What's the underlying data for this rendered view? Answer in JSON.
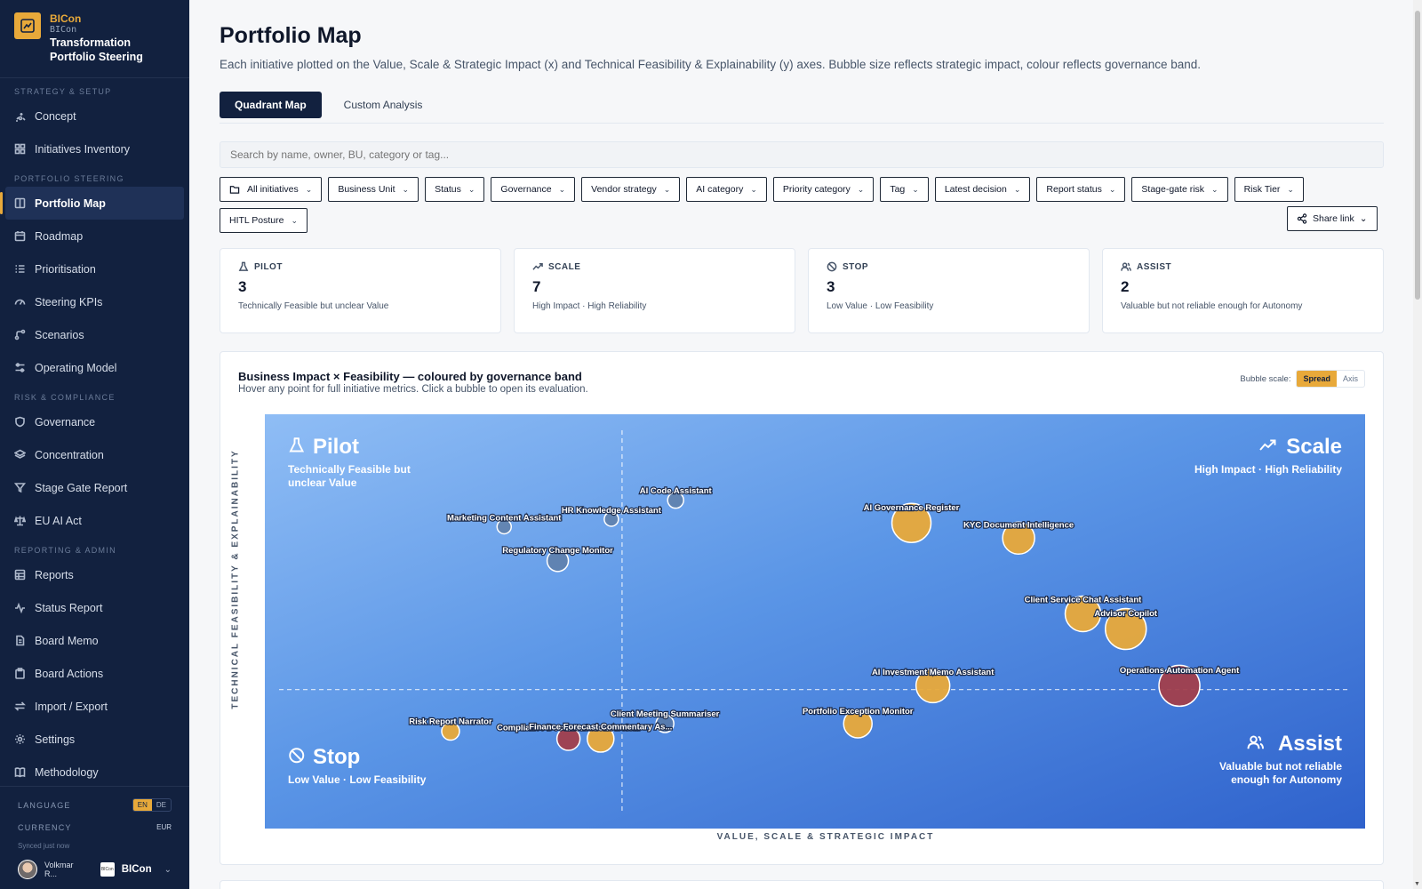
{
  "brand": {
    "name": "BICon",
    "code": "BICon",
    "app_title": "Transformation Portfolio Steering"
  },
  "nav": {
    "sections": [
      {
        "label": "STRATEGY & SETUP",
        "items": [
          {
            "label": "Concept",
            "icon": "sparkle-icon"
          },
          {
            "label": "Initiatives Inventory",
            "icon": "grid-icon"
          }
        ]
      },
      {
        "label": "PORTFOLIO STEERING",
        "items": [
          {
            "label": "Portfolio Map",
            "icon": "map-icon",
            "active": true
          },
          {
            "label": "Roadmap",
            "icon": "calendar-icon"
          },
          {
            "label": "Prioritisation",
            "icon": "list-icon"
          },
          {
            "label": "Steering KPIs",
            "icon": "gauge-icon"
          },
          {
            "label": "Scenarios",
            "icon": "branch-icon"
          },
          {
            "label": "Operating Model",
            "icon": "sliders-icon"
          }
        ]
      },
      {
        "label": "RISK & COMPLIANCE",
        "items": [
          {
            "label": "Governance",
            "icon": "shield-icon"
          },
          {
            "label": "Concentration",
            "icon": "layers-icon"
          },
          {
            "label": "Stage Gate Report",
            "icon": "funnel-icon"
          },
          {
            "label": "EU AI Act",
            "icon": "scale-icon"
          }
        ]
      },
      {
        "label": "REPORTING & ADMIN",
        "items": [
          {
            "label": "Reports",
            "icon": "table-icon"
          },
          {
            "label": "Status Report",
            "icon": "pulse-icon"
          },
          {
            "label": "Board Memo",
            "icon": "document-icon"
          },
          {
            "label": "Board Actions",
            "icon": "clipboard-icon"
          },
          {
            "label": "Import / Export",
            "icon": "swap-icon"
          },
          {
            "label": "Settings",
            "icon": "gear-icon"
          },
          {
            "label": "Methodology",
            "icon": "book-icon"
          }
        ]
      }
    ]
  },
  "footer": {
    "language_label": "LANGUAGE",
    "lang_en": "EN",
    "lang_de": "DE",
    "currency_label": "CURRENCY",
    "currency": "EUR",
    "synced": "Synced just now",
    "user": "Volkmar R...",
    "org": "BICon"
  },
  "page": {
    "title": "Portfolio Map",
    "subtitle": "Each initiative plotted on the Value, Scale & Strategic Impact (x) and Technical Feasibility & Explainability (y) axes. Bubble size reflects strategic impact, colour reflects governance band.",
    "tabs": [
      {
        "label": "Quadrant Map",
        "active": true
      },
      {
        "label": "Custom Analysis"
      }
    ],
    "search_placeholder": "Search by name, owner, BU, category or tag...",
    "filters": [
      "All initiatives",
      "Business Unit",
      "Status",
      "Governance",
      "Vendor strategy",
      "AI category",
      "Priority category",
      "Tag",
      "Latest decision",
      "Report status",
      "Stage-gate risk",
      "Risk Tier",
      "HITL Posture"
    ],
    "share_label": "Share link"
  },
  "cards": [
    {
      "label": "PILOT",
      "count": "3",
      "desc": "Technically Feasible but unclear Value",
      "icon": "flask-icon"
    },
    {
      "label": "SCALE",
      "count": "7",
      "desc": "High Impact · High Reliability",
      "icon": "trend-up-icon"
    },
    {
      "label": "STOP",
      "count": "3",
      "desc": "Low Value · Low Feasibility",
      "icon": "ban-icon"
    },
    {
      "label": "ASSIST",
      "count": "2",
      "desc": "Valuable but not reliable enough for Autonomy",
      "icon": "users-icon"
    }
  ],
  "chart_panel": {
    "title": "Business Impact × Feasibility — coloured by governance band",
    "subtitle": "Hover any point for full initiative metrics. Click a bubble to open its evaluation.",
    "bubble_scale_label": "Bubble scale:",
    "spread": "Spread",
    "axis": "Axis"
  },
  "chart_data": {
    "type": "scatter",
    "xlabel": "VALUE, SCALE & STRATEGIC IMPACT",
    "ylabel": "TECHNICAL FEASIBILITY & EXPLAINABILITY",
    "xlim": [
      0,
      100
    ],
    "ylim": [
      0,
      100
    ],
    "dividers": {
      "x": 32,
      "y": 32
    },
    "quadrants": [
      {
        "name": "Pilot",
        "desc": "Technically Feasible but unclear Value",
        "pos": "top-left",
        "icon": "flask-icon"
      },
      {
        "name": "Scale",
        "desc": "High Impact · High Reliability",
        "pos": "top-right",
        "icon": "trend-up-icon"
      },
      {
        "name": "Stop",
        "desc": "Low Value · Low Feasibility",
        "pos": "bottom-left",
        "icon": "ban-icon"
      },
      {
        "name": "Assist",
        "desc": "Valuable but not reliable enough for Autonomy",
        "pos": "bottom-right",
        "icon": "users-icon"
      }
    ],
    "colors": {
      "amber": "#e8a93a",
      "red": "#a23f4c",
      "slate": "#5b7393"
    },
    "points": [
      {
        "name": "AI Code Assistant",
        "x": 37,
        "y": 82,
        "size": 9,
        "band": "slate"
      },
      {
        "name": "HR Knowledge Assistant",
        "x": 31,
        "y": 77,
        "size": 8,
        "band": "slate"
      },
      {
        "name": "Marketing Content Assistant",
        "x": 21,
        "y": 75,
        "size": 8,
        "band": "slate"
      },
      {
        "name": "Regulatory Change Monitor",
        "x": 26,
        "y": 66,
        "size": 12,
        "band": "slate"
      },
      {
        "name": "AI Governance Register",
        "x": 59,
        "y": 76,
        "size": 22,
        "band": "amber"
      },
      {
        "name": "KYC Document Intelligence",
        "x": 69,
        "y": 72,
        "size": 18,
        "band": "amber"
      },
      {
        "name": "Client Service Chat Assistant",
        "x": 75,
        "y": 52,
        "size": 20,
        "band": "amber"
      },
      {
        "name": "Advisor Copilot",
        "x": 79,
        "y": 48,
        "size": 23,
        "band": "amber"
      },
      {
        "name": "AI Investment Memo Assistant",
        "x": 61,
        "y": 33,
        "size": 19,
        "band": "amber"
      },
      {
        "name": "Operations Automation Agent",
        "x": 84,
        "y": 33,
        "size": 23,
        "band": "red"
      },
      {
        "name": "Portfolio Exception Monitor",
        "x": 54,
        "y": 23,
        "size": 16,
        "band": "amber"
      },
      {
        "name": "Client Meeting Summariser",
        "x": 36,
        "y": 23,
        "size": 10,
        "band": "slate"
      },
      {
        "name": "Risk Report Narrator",
        "x": 16,
        "y": 21,
        "size": 10,
        "band": "amber"
      },
      {
        "name": "Compliance Documentation Assis...",
        "x": 27,
        "y": 19,
        "size": 13,
        "band": "red"
      },
      {
        "name": "Finance Forecast Commentary As...",
        "x": 30,
        "y": 19,
        "size": 15,
        "band": "amber"
      }
    ]
  }
}
